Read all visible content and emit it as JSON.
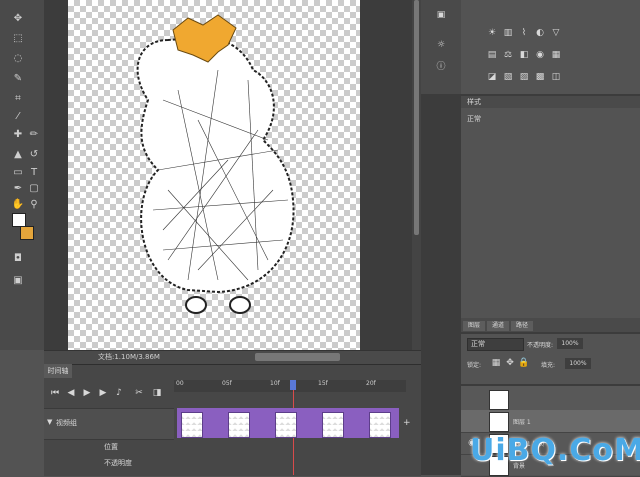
{
  "document": {
    "status_text": "文档:1.10M/3.86M"
  },
  "tool_colors": {
    "foreground": "#ffffff",
    "background": "#e4a53b"
  },
  "timeline": {
    "tab_label": "时间轴",
    "ruler_labels": [
      "00",
      "05f",
      "10f",
      "15f",
      "20f"
    ],
    "track_name": "视频组",
    "sub_rows": [
      "位置",
      "不透明度"
    ]
  },
  "styles_panel": {
    "title": "样式",
    "label": "正常"
  },
  "layers_panel": {
    "tabs": [
      "图层",
      "通道",
      "路径"
    ],
    "blend_mode": "正常",
    "opacity_label": "不透明度:",
    "opacity_value": "100%",
    "fill_label": "填充:",
    "fill_value": "100%",
    "lock_label": "锁定:",
    "layers": [
      {
        "name": "图层 1"
      },
      {
        "name": "图层 1 拷贝"
      },
      {
        "name": "背景"
      }
    ]
  },
  "watermark": {
    "text": "UiBQ.CoM"
  },
  "icons": [
    "move-icon",
    "marquee-icon",
    "lasso-icon",
    "quick-select-icon",
    "crop-icon",
    "eyedropper-icon",
    "healing-icon",
    "brush-icon",
    "stamp-icon",
    "history-brush-icon",
    "eraser-icon",
    "gradient-icon",
    "blur-icon",
    "dodge-icon",
    "pen-icon",
    "type-icon",
    "path-select-icon",
    "shape-icon",
    "hand-icon",
    "zoom-icon"
  ]
}
